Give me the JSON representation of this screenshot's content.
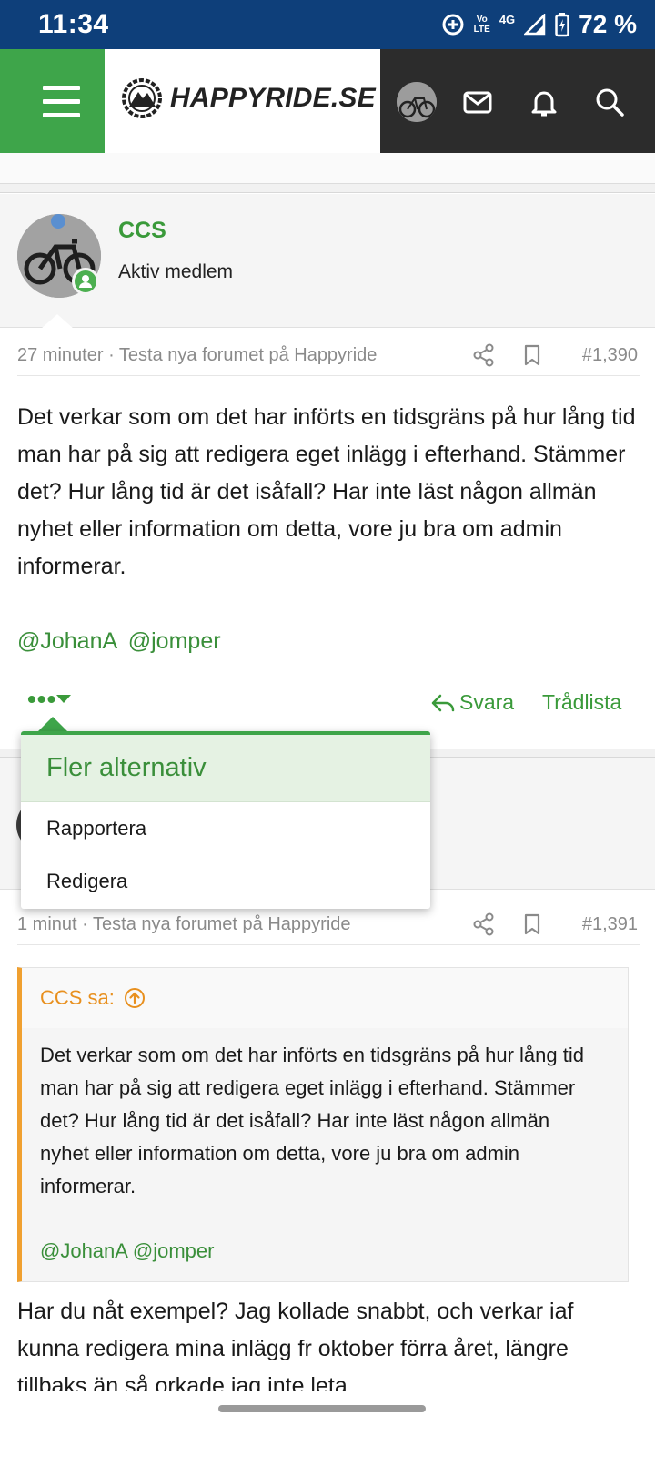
{
  "status_bar": {
    "time": "11:34",
    "lte_top": "Vo",
    "lte_bottom": "LTE",
    "network": "4G",
    "battery": "72 %"
  },
  "header": {
    "site_name": "HAPPYRIDE.SE",
    "menu_icon": "hamburger-icon",
    "icons": [
      "avatar",
      "mail-icon",
      "bell-icon",
      "search-icon"
    ]
  },
  "post1": {
    "username": "CCS",
    "user_title": "Aktiv medlem",
    "time": "27 minuter",
    "thread": "Testa nya forumet på Happyride",
    "post_number": "#1,390",
    "body": "Det verkar som om det har införts en tidsgräns på hur lång tid man har på sig att redigera eget inlägg i efterhand. Stämmer det? Hur lång tid är det isåfall? Har inte läst någon allmän nyhet eller information om detta, vore ju bra om admin informerar.",
    "mentions": [
      "@JohanA",
      "@jomper"
    ],
    "more_label": "•••",
    "reply_label": "Svara",
    "thread_list_label": "Trådlista"
  },
  "dropdown": {
    "title": "Fler alternativ",
    "items": [
      "Rapportera",
      "Redigera"
    ]
  },
  "post2": {
    "time": "1 minut",
    "thread": "Testa nya forumet på Happyride",
    "post_number": "#1,391",
    "quote_author": "CCS sa:",
    "quote_body": "Det verkar som om det har införts en tidsgräns på hur lång tid man har på sig att redigera eget inlägg i efterhand. Stämmer det? Hur lång tid är det isåfall? Har inte läst någon allmän nyhet eller information om detta, vore ju bra om admin informerar.",
    "quote_mentions": [
      "@JohanA",
      "@jomper"
    ],
    "body": "Har du nåt exempel? Jag kollade snabbt, och verkar iaf kunna redigera mina inlägg fr oktober förra året, längre tillbaks än så orkade jag inte leta."
  },
  "colors": {
    "brand_green": "#3ea54a",
    "status_bar": "#0e3f7a",
    "quote_accent": "#f0a030"
  }
}
